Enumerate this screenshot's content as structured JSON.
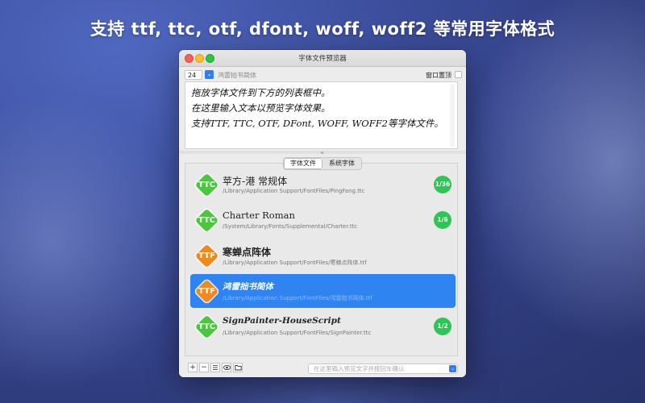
{
  "headline": "支持 ttf, ttc, otf, dfont, woff, woff2 等常用字体格式",
  "window": {
    "title": "字体文件预览器"
  },
  "toolbar": {
    "font_size": "24",
    "dropdown_glyph": "⌄",
    "current_font": "鸿雷拙书简体",
    "pin_label": "窗口置顶"
  },
  "preview": {
    "lines": [
      "拖放字体文件到下方的列表框中。",
      "在这里输入文本以预览字体效果。",
      "支持TTF, TTC, OTF, DFont, WOFF, WOFF2等字体文件。"
    ]
  },
  "tabs": [
    {
      "label": "字体文件",
      "active": true
    },
    {
      "label": "系统字体",
      "active": false
    }
  ],
  "fonts": [
    {
      "type": "TTC",
      "name": "苹方-港 常规体",
      "path": "/Library/Application Support/FontFiles/PingFang.ttc",
      "count": "1/36",
      "style": "sans",
      "color": "#4cc63e",
      "selected": false
    },
    {
      "type": "TTC",
      "name": "Charter Roman",
      "path": "/System/Library/Fonts/Supplemental/Charter.ttc",
      "count": "1/6",
      "style": "serif",
      "color": "#4cc63e",
      "selected": false
    },
    {
      "type": "TTF",
      "name": "寒蝉点阵体",
      "path": "/Library/Application Support/FontFiles/寒蝉点阵体.ttf",
      "count": "",
      "style": "bold",
      "color": "#f08a1c",
      "selected": false
    },
    {
      "type": "TTF",
      "name": "鸿雷拙书简体",
      "path": "/Library/Application Support/FontFiles/鸿雷拙书简体.ttf",
      "count": "",
      "style": "script",
      "color": "#f08a1c",
      "selected": true
    },
    {
      "type": "TTC",
      "name": "SignPainter-HouseScript",
      "path": "/Library/Application Support/FontFiles/SignPainter.ttc",
      "count": "1/2",
      "style": "script",
      "color": "#4cc63e",
      "selected": false
    }
  ],
  "bottombar": {
    "add": "+",
    "remove": "−",
    "search_placeholder": "在这里输入预览文字并按回车确认",
    "go_glyph": "⌄"
  },
  "colors": {
    "accent": "#2f84f2",
    "ttc": "#4cc63e",
    "ttf": "#f08a1c",
    "count_badge": "#2dc553"
  }
}
